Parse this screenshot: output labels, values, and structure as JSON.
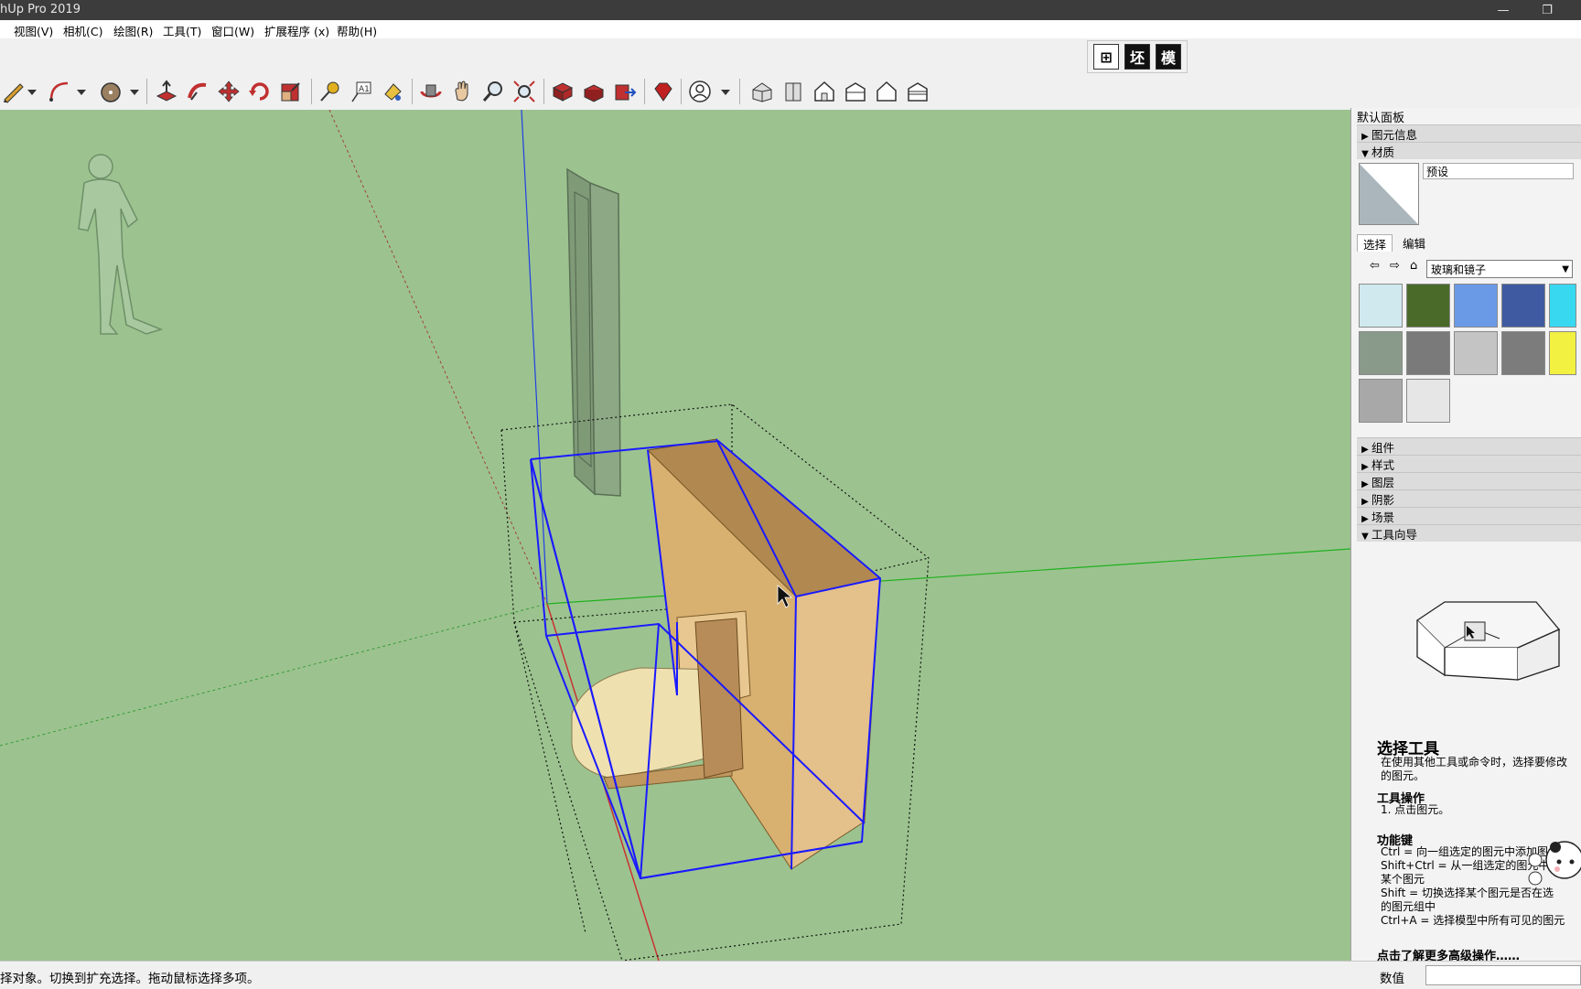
{
  "window": {
    "title": "hUp Pro 2019",
    "minimize": "—",
    "restore": "❐"
  },
  "menu": [
    {
      "label": "视图(V)"
    },
    {
      "label": "相机(C)"
    },
    {
      "label": "绘图(R)"
    },
    {
      "label": "工具(T)"
    },
    {
      "label": "窗口(W)"
    },
    {
      "label": "扩展程序 (x)"
    },
    {
      "label": "帮助(H)"
    }
  ],
  "extra_toolbar": {
    "buttons": [
      "⊞",
      "坯",
      "模"
    ]
  },
  "toolbar": {
    "tools": [
      "pencil-icon",
      "arc-icon",
      "shape-icon",
      "pushpull-icon",
      "followme-icon",
      "move-icon",
      "rotate-icon",
      "scale-icon",
      "tape-icon",
      "text-icon",
      "paint-icon",
      "orbit-icon",
      "pan-icon",
      "zoom-icon",
      "zoom-extents-icon",
      "warehouse-icon",
      "extension-warehouse-icon",
      "send-icon",
      "ruby-icon",
      "account-icon",
      "iso-view-icon",
      "top-view-icon",
      "front-view-icon",
      "right-view-icon",
      "back-view-icon",
      "left-view-icon"
    ]
  },
  "panel": {
    "title": "默认面板",
    "entity_info": "图元信息",
    "materials": "材质",
    "material_name": "预设",
    "tab_select": "选择",
    "tab_edit": "编辑",
    "library": "玻璃和镜子",
    "swatch_colors": [
      "#cfe9ef",
      "#4a6a2a",
      "#6a9ae6",
      "#3f5aa0",
      "#38d8f0",
      "#8a9a8a",
      "#7a7a7a",
      "#c4c4c4",
      "#7c7c7c",
      "#f2f040",
      "#a8a8a8",
      "#e6e6e6"
    ],
    "sections": [
      "组件",
      "样式",
      "图层",
      "阴影",
      "场景",
      "工具向导"
    ],
    "instructor": {
      "title": "选择工具",
      "desc": "在使用其他工具或命令时，选择要修改的图元。",
      "ops_heading": "工具操作",
      "ops": "1. 点击图元。",
      "keys_heading": "功能键",
      "keys": "Ctrl = 向一组选定的图元中添加图\nShift+Ctrl = 从一组选定的图元中\n某个图元\nShift = 切换选择某个图元是否在选\n的图元组中\nCtrl+A = 选择模型中所有可见的图元",
      "more_link": "点击了解更多高级操作……"
    }
  },
  "status": {
    "message": "择对象。切换到扩充选择。拖动鼠标选择多项。",
    "value_label": "数值"
  },
  "colors": {
    "viewport_bg": "#9cc38f",
    "selection_blue": "#1a1aff",
    "axis_red": "#c83232",
    "axis_green": "#20b020",
    "axis_blue": "#2040e0"
  }
}
